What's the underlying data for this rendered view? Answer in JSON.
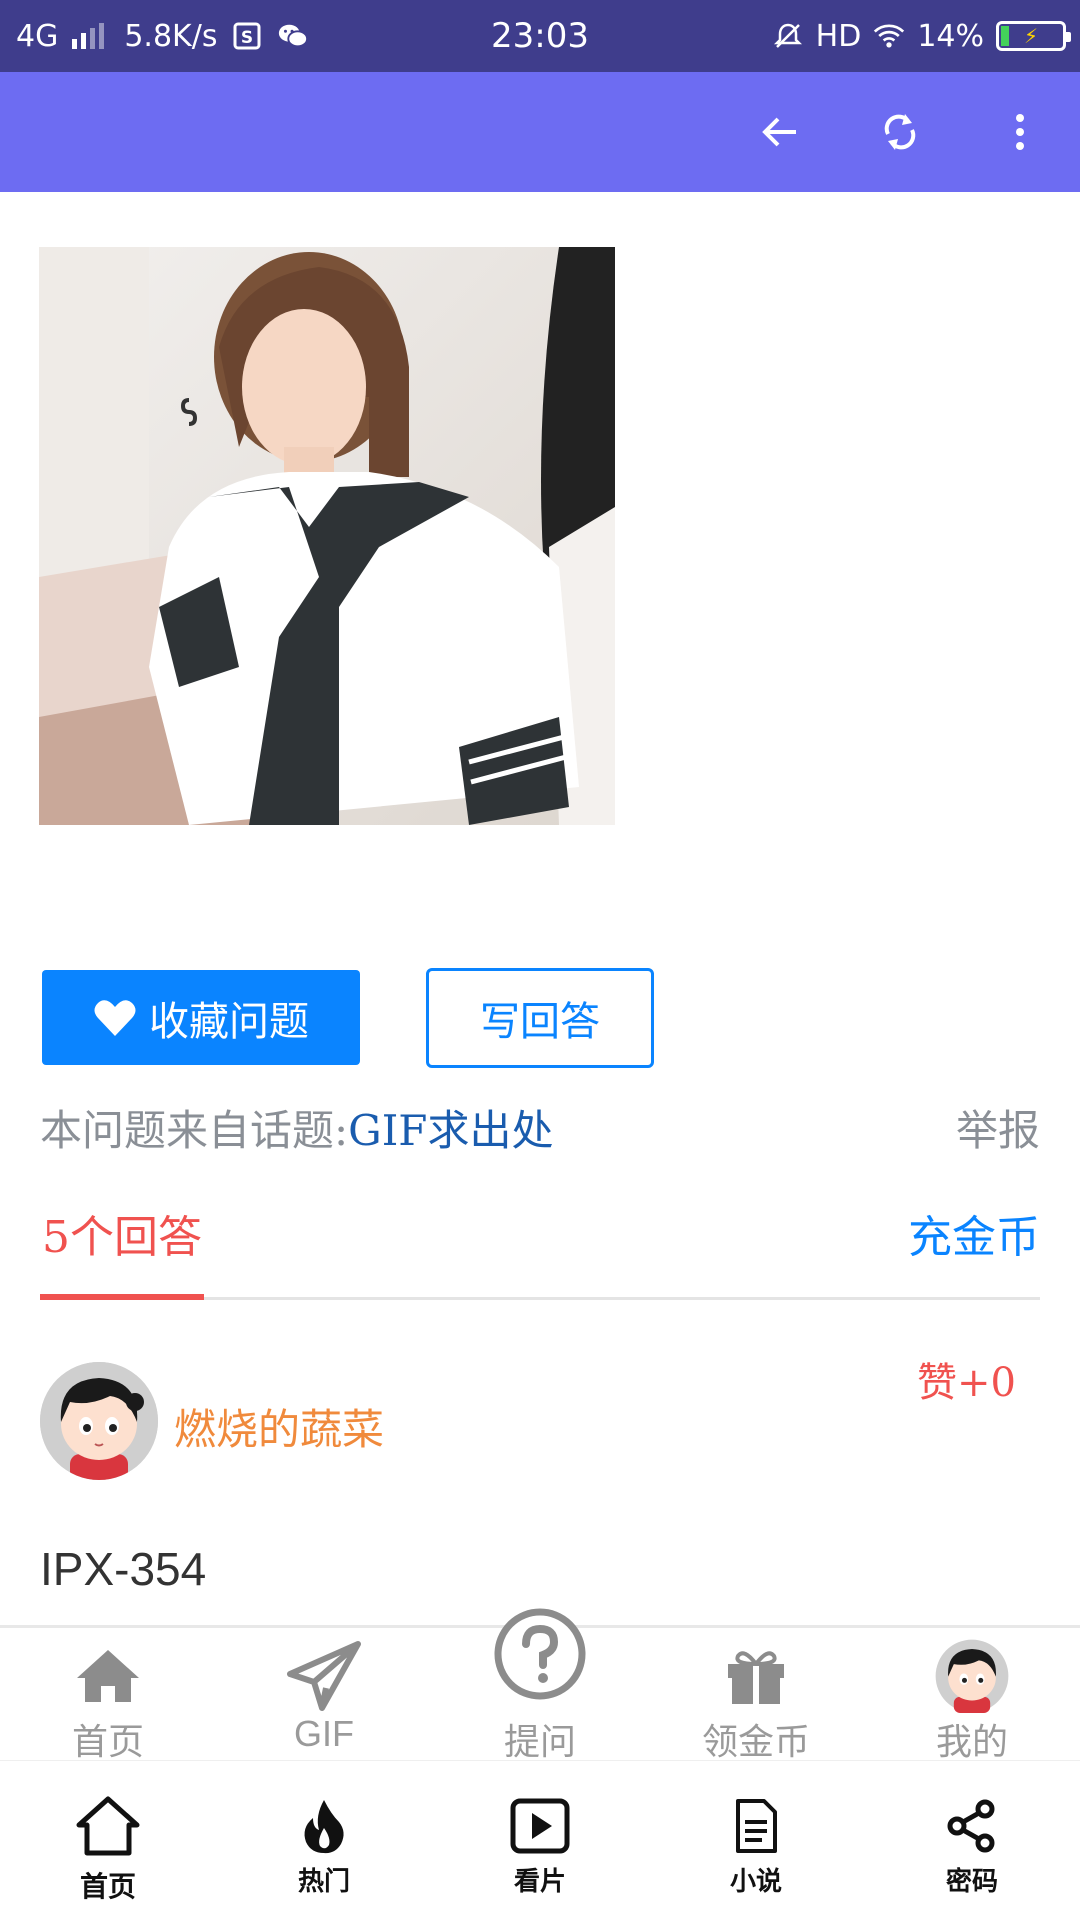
{
  "status_bar": {
    "network": "4G",
    "speed": "5.8K/s",
    "time": "23:03",
    "hd": "HD",
    "battery": "14%"
  },
  "app_bar": {
    "back_icon": "arrow-left-icon",
    "refresh_icon": "sync-icon",
    "menu_icon": "more-vert-icon"
  },
  "question": {
    "image_alt_icon": "photo"
  },
  "actions": {
    "favorite_label": "收藏问题",
    "write_answer_label": "写回答"
  },
  "topic": {
    "prefix": "本问题来自话题:",
    "link": "GIF求出处",
    "report": "举报"
  },
  "tabs": {
    "answers": "5个回答",
    "recharge": "充金币"
  },
  "answer": {
    "username": "燃烧的蔬菜",
    "likes": "赞+0",
    "text": "IPX-354"
  },
  "bottom_nav": [
    {
      "label": "首页",
      "icon": "home-icon"
    },
    {
      "label": "GIF",
      "icon": "paper-plane-icon"
    },
    {
      "label": "提问",
      "icon": "question-circle-icon"
    },
    {
      "label": "领金币",
      "icon": "gift-icon"
    },
    {
      "label": "我的",
      "icon": "avatar-icon"
    }
  ],
  "sys_nav": [
    {
      "label": "首页",
      "icon": "home-outline-icon"
    },
    {
      "label": "热门",
      "icon": "fire-icon"
    },
    {
      "label": "看片",
      "icon": "play-square-icon"
    },
    {
      "label": "小说",
      "icon": "document-icon"
    },
    {
      "label": "密码",
      "icon": "share-icon"
    }
  ],
  "colors": {
    "status_bar": "#3f3d8c",
    "app_bar": "#6d6cf2",
    "primary": "#0a84ff",
    "accent_red": "#f0524f",
    "username_orange": "#f08a3c"
  }
}
